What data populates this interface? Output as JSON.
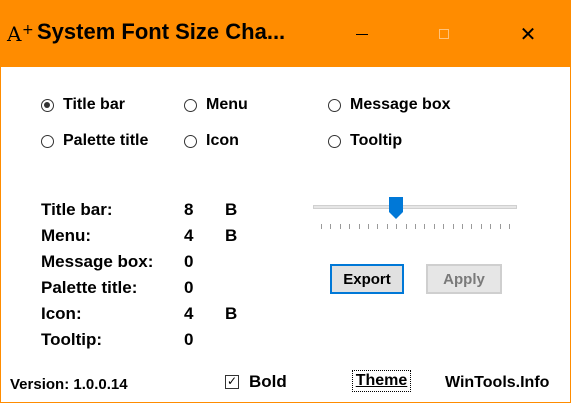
{
  "window": {
    "title": "System Font Size Cha...",
    "icon": "font-a-plus-icon",
    "accent_color": "#ff8c00"
  },
  "controls": {
    "minimize": "minimize-icon",
    "maximize": "maximize-icon",
    "close": "close-icon",
    "close_glyph": "✕"
  },
  "radios": {
    "items": [
      {
        "label": "Title bar",
        "selected": true
      },
      {
        "label": "Menu",
        "selected": false
      },
      {
        "label": "Message box",
        "selected": false
      },
      {
        "label": "Palette title",
        "selected": false
      },
      {
        "label": "Icon",
        "selected": false
      },
      {
        "label": "Tooltip",
        "selected": false
      }
    ]
  },
  "info": {
    "rows": [
      {
        "label": "Title bar:",
        "value": "8",
        "flag": "B"
      },
      {
        "label": "Menu:",
        "value": "4",
        "flag": "B"
      },
      {
        "label": "Message box:",
        "value": "0",
        "flag": ""
      },
      {
        "label": "Palette title:",
        "value": "0",
        "flag": ""
      },
      {
        "label": "Icon:",
        "value": "4",
        "flag": "B"
      },
      {
        "label": "Tooltip:",
        "value": "0",
        "flag": ""
      }
    ]
  },
  "slider": {
    "position_fraction": 0.4
  },
  "buttons": {
    "export": "Export",
    "apply": "Apply"
  },
  "footer": {
    "version": "Version: 1.0.0.14",
    "bold_label": "Bold",
    "bold_checked": true,
    "check_glyph": "✓",
    "theme": "Theme",
    "site": "WinTools.Info"
  }
}
